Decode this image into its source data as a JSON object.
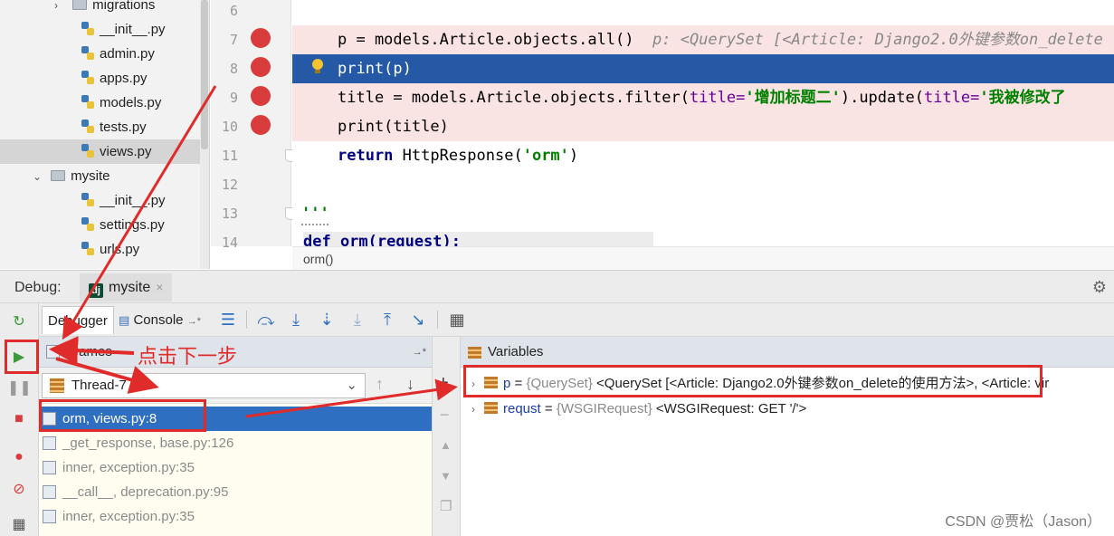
{
  "tree": {
    "items": [
      {
        "label": "migrations",
        "type": "folder",
        "expand": "›"
      },
      {
        "label": "__init__.py",
        "type": "py"
      },
      {
        "label": "admin.py",
        "type": "py"
      },
      {
        "label": "apps.py",
        "type": "py"
      },
      {
        "label": "models.py",
        "type": "py"
      },
      {
        "label": "tests.py",
        "type": "py"
      },
      {
        "label": "views.py",
        "type": "py",
        "selected": true
      },
      {
        "label": "mysite",
        "type": "folder",
        "expand": "⌄"
      },
      {
        "label": "__init__.py",
        "type": "py"
      },
      {
        "label": "settings.py",
        "type": "py"
      },
      {
        "label": "urls.py",
        "type": "py"
      }
    ]
  },
  "editor": {
    "line_numbers": [
      "6",
      "7",
      "8",
      "9",
      "10",
      "11",
      "12",
      "13",
      "14"
    ],
    "breakpoint_lines": [
      "7",
      "8",
      "9",
      "10"
    ],
    "current_line": "8",
    "lines": {
      "l7_code": "p = models.Article.objects.all()",
      "l7_inline": "p: <QuerySet [<Article: Django2.0外键参数on_delete",
      "l8_code": "print(p)",
      "l9_a": "title = models.Article.objects.filter(",
      "l9_kw1": "title=",
      "l9_s1": "'增加标题二'",
      "l9_b": ").update(",
      "l9_kw2": "title=",
      "l9_s2": "'我被修改了",
      "l10_code": "print(title)",
      "l11_kw": "return",
      "l11_a": " HttpResponse(",
      "l11_s": "'orm'",
      "l11_b": ")",
      "l13_code": "'''",
      "l14_code": "def orm(request):"
    },
    "breadcrumb": "orm()"
  },
  "debug": {
    "label": "Debug:",
    "run_tab": "mysite",
    "run_tab_icon": "django-icon",
    "tabs": {
      "debugger": "Debugger",
      "console": "Console",
      "console_suffix": "→*"
    },
    "frames": {
      "header": "Frames",
      "thread": "Thread-7",
      "items": [
        {
          "label": "orm, views.py:8",
          "selected": true
        },
        {
          "label": "_get_response, base.py:126"
        },
        {
          "label": "inner, exception.py:35"
        },
        {
          "label": "__call__, deprecation.py:95"
        },
        {
          "label": "inner, exception.py:35"
        }
      ]
    },
    "variables": {
      "header": "Variables",
      "items": [
        {
          "name": "p",
          "type": "{QuerySet}",
          "value": "<QuerySet [<Article: Django2.0外键参数on_delete的使用方法>, <Article: vir"
        },
        {
          "name": "requst",
          "type": "{WSGIRequest}",
          "value": "<WSGIRequest: GET '/'>"
        }
      ]
    }
  },
  "annotation": {
    "step_label": "点击下一步",
    "color": "#e02b2b"
  },
  "watermark": "CSDN @贾松（Jason）"
}
